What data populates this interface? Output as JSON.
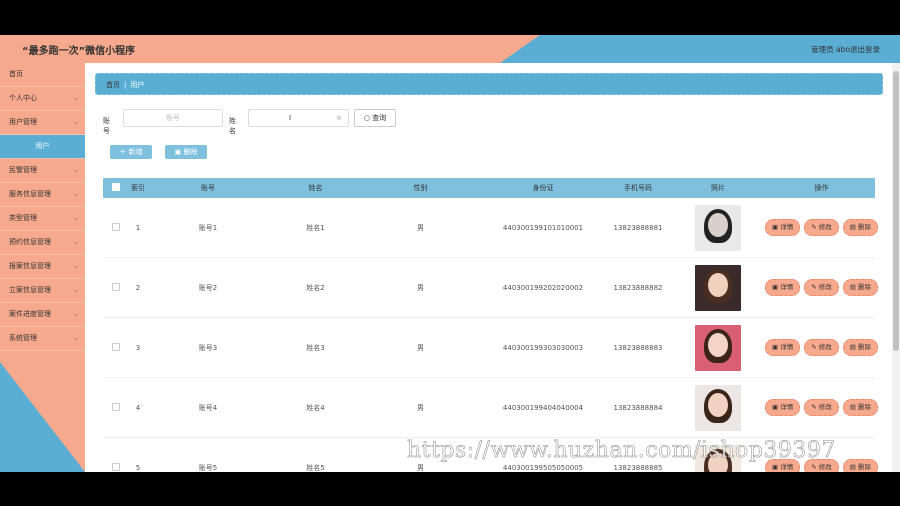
{
  "header": {
    "title": "“最多跑一次”微信小程序",
    "admin_label": "管理员 abo",
    "logout_label": "退出登录"
  },
  "sidebar": {
    "items": [
      {
        "label": "首页",
        "chevron": false,
        "active": false
      },
      {
        "label": "个人中心",
        "chevron": true,
        "active": false
      },
      {
        "label": "用户管理",
        "chevron": true,
        "active": false
      },
      {
        "label": "用户",
        "chevron": false,
        "active": true
      },
      {
        "label": "民警管理",
        "chevron": true,
        "active": false
      },
      {
        "label": "服务信息管理",
        "chevron": true,
        "active": false
      },
      {
        "label": "类型管理",
        "chevron": true,
        "active": false
      },
      {
        "label": "预约信息管理",
        "chevron": true,
        "active": false
      },
      {
        "label": "报案信息管理",
        "chevron": true,
        "active": false
      },
      {
        "label": "立案信息管理",
        "chevron": true,
        "active": false
      },
      {
        "label": "案件进度管理",
        "chevron": true,
        "active": false
      },
      {
        "label": "系统管理",
        "chevron": true,
        "active": false
      }
    ]
  },
  "breadcrumb": {
    "home": "首页",
    "current": "用户"
  },
  "search": {
    "account_label": "账号",
    "account_placeholder": "账号",
    "name_label": "姓名",
    "name_value": "",
    "search_button": "查询"
  },
  "toolbar": {
    "add_label": "新增",
    "delete_label": "删除"
  },
  "table": {
    "headers": [
      "索引",
      "账号",
      "姓名",
      "性别",
      "身份证",
      "手机号码",
      "照片",
      "操作"
    ],
    "rows": [
      {
        "index": "1",
        "account": "账号1",
        "name": "姓名1",
        "gender": "男",
        "id_card": "440300199101010001",
        "phone": "13823888881"
      },
      {
        "index": "2",
        "account": "账号2",
        "name": "姓名2",
        "gender": "男",
        "id_card": "440300199202020002",
        "phone": "13823888882"
      },
      {
        "index": "3",
        "account": "账号3",
        "name": "姓名3",
        "gender": "男",
        "id_card": "440300199303030003",
        "phone": "13823888883"
      },
      {
        "index": "4",
        "account": "账号4",
        "name": "姓名4",
        "gender": "男",
        "id_card": "440300199404040004",
        "phone": "13823888884"
      },
      {
        "index": "5",
        "account": "账号5",
        "name": "姓名5",
        "gender": "男",
        "id_card": "440300199505050005",
        "phone": "13823888885"
      }
    ],
    "actions": {
      "detail": "详情",
      "edit": "修改",
      "delete": "删除"
    }
  },
  "watermark": "https://www.huzhan.com/ishop39397",
  "colors": {
    "salmon": "#f7a98d",
    "blue": "#5aaed4",
    "table_header": "#7fc0de"
  },
  "icons": {
    "search": "search-icon",
    "add": "plus-icon",
    "delete": "trash-icon",
    "detail": "detail-icon",
    "edit": "edit-icon"
  }
}
